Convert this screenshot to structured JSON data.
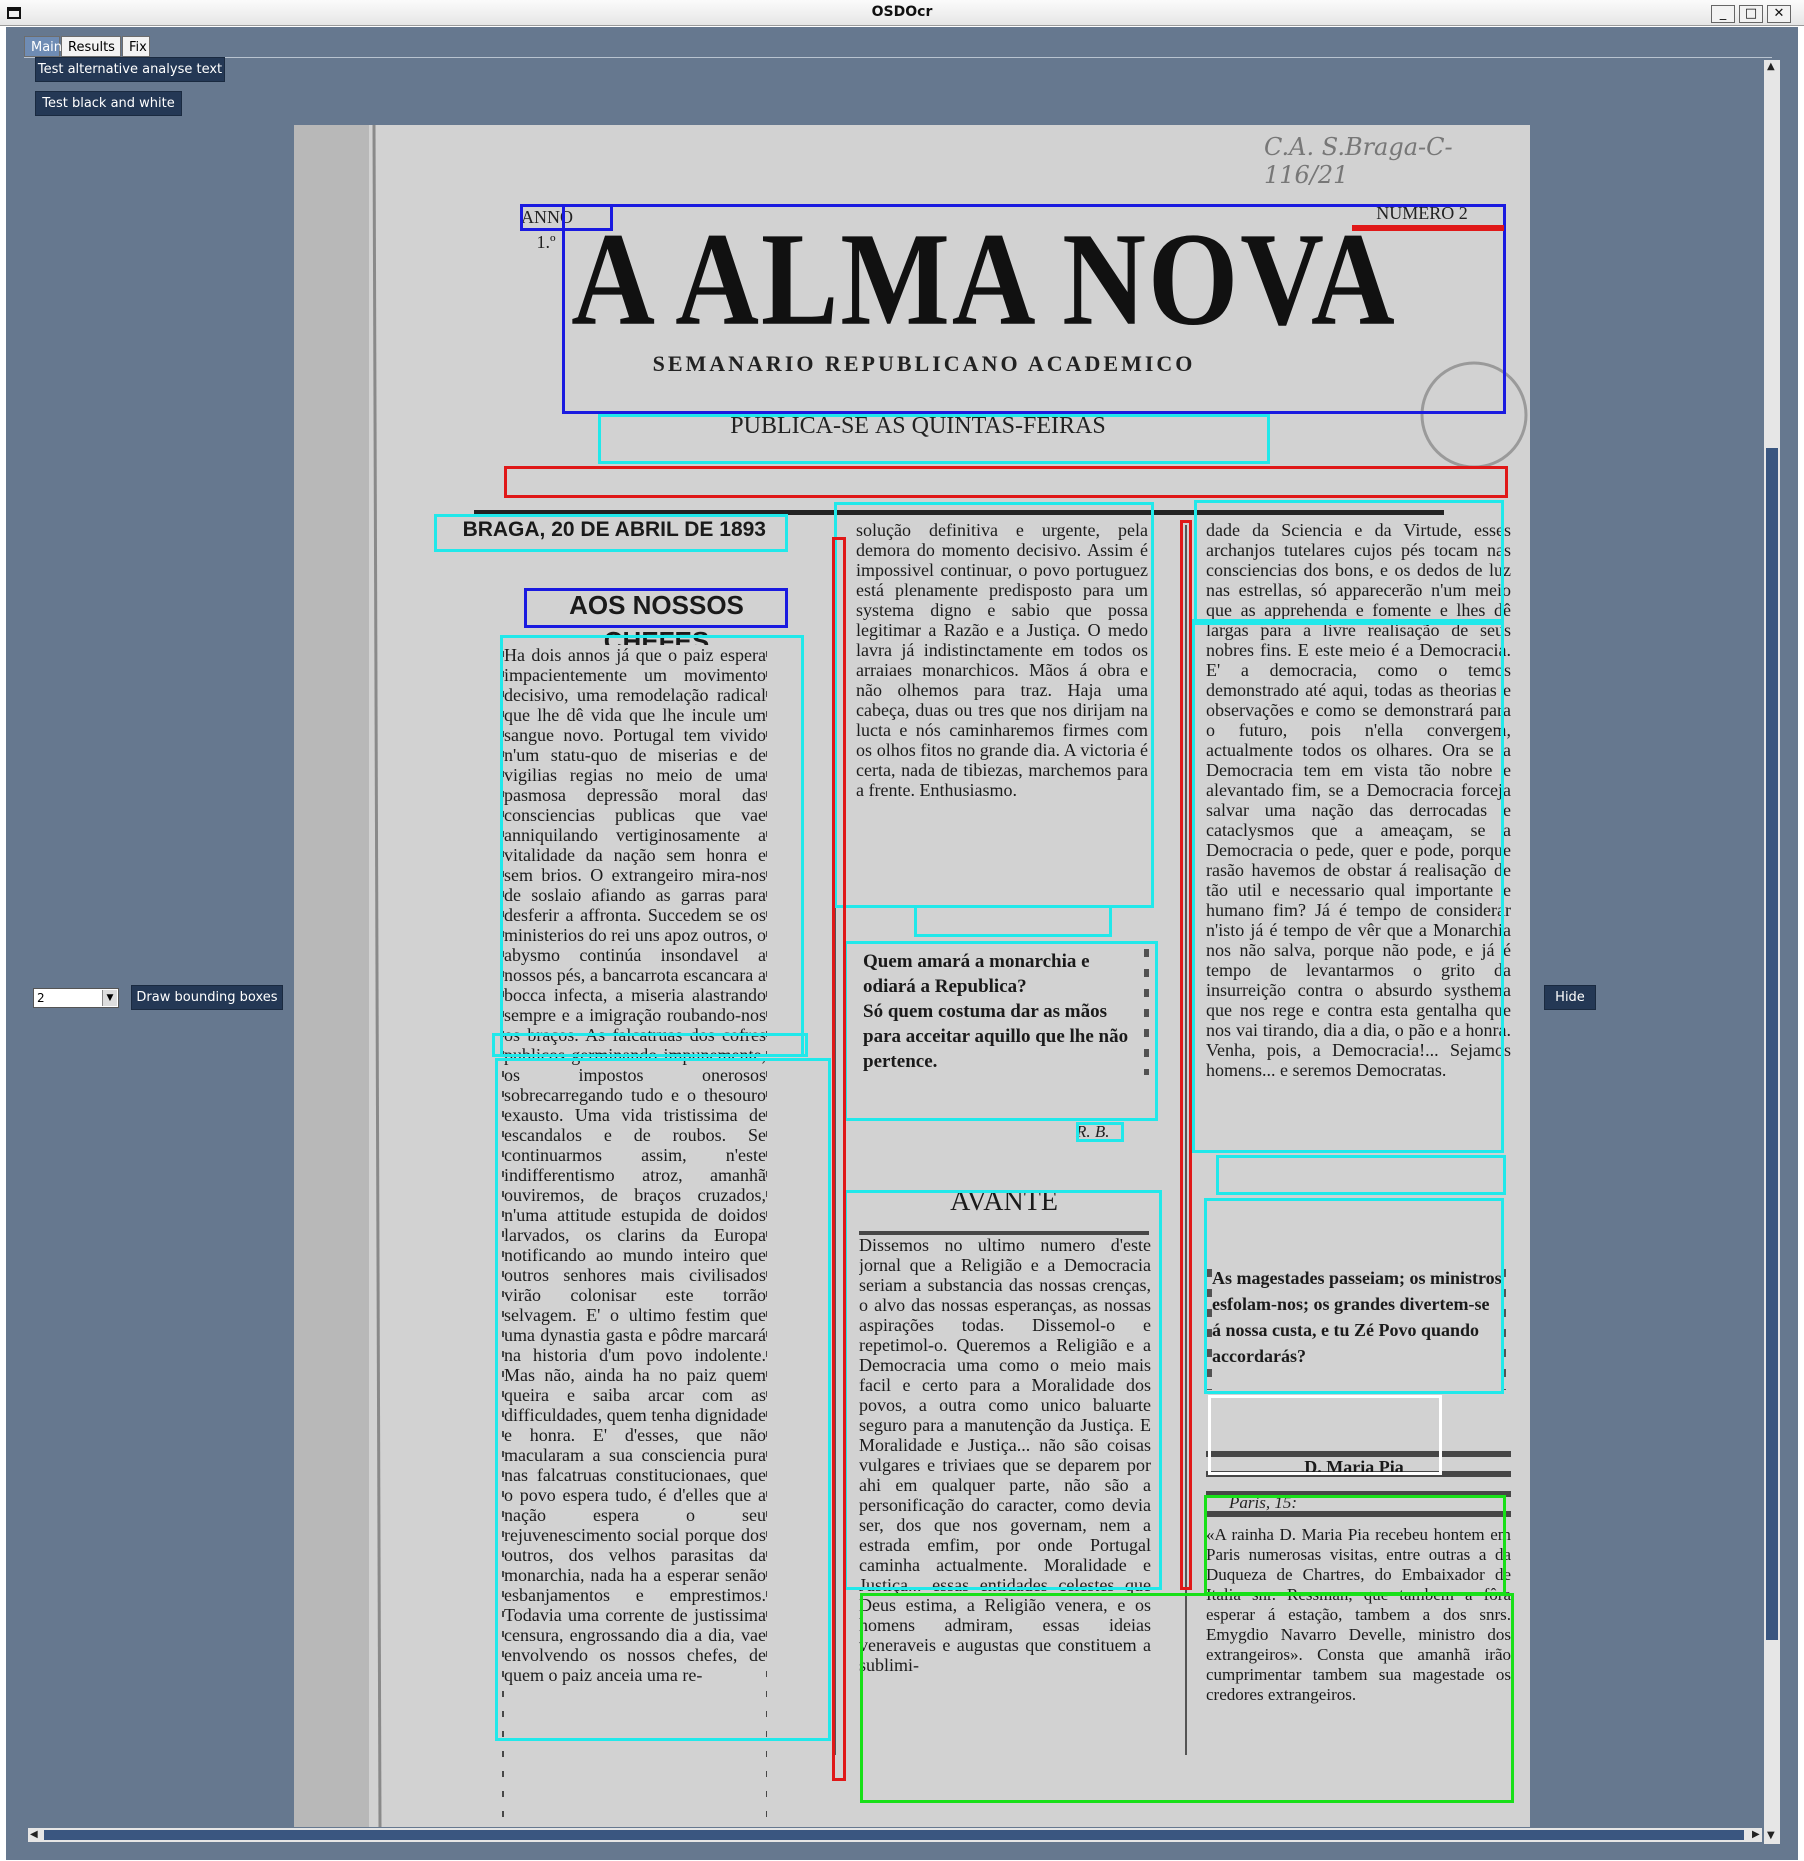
{
  "window": {
    "title": "OSDOcr",
    "minimize_label": "_",
    "maximize_label": "□",
    "close_label": "✕"
  },
  "tabs": [
    {
      "label": "Main",
      "active": true
    },
    {
      "label": "Results",
      "active": false
    },
    {
      "label": "Fix",
      "active": false
    }
  ],
  "buttons": {
    "test_alternative": "Test alternative analyse text",
    "test_black_white": "Test black and white",
    "draw_bounding_boxes": "Draw bounding boxes",
    "hide": "Hide"
  },
  "select": {
    "value": "2"
  },
  "newspaper": {
    "anno": "ANNO 1.º",
    "numero": "NUMERO 2",
    "handwritten": "C.A. S.Braga-C-116/21",
    "title": "A ALMA NOVA",
    "subtitle": "SEMANARIO REPUBLICANO ACADEMICO",
    "publication": "PUBLICA-SE ÁS QUINTAS-FEIRAS",
    "dateline": "BRAGA, 20 DE ABRIL DE 1893",
    "heading_left": "AOS NOSSOS CHEFES",
    "quote_bold": "Quem amará a monarchia e odiará a Republica?",
    "quote_bold2": "Só quem costuma dar as mãos para acceitar aquillo que lhe não pertence.",
    "signature_rb": "R. B.",
    "heading_avante": "AVANTE",
    "right_quote": "As magestades passeiam; os ministros esfolam-nos; os grandes divertem-se á nossa custa, e tu Zé Povo quando accordarás?",
    "signature_pia": "D. Maria Pia",
    "paris": "Paris, 15:",
    "col1": "Ha dois annos já que o paiz espera impacientemente um movimento decisivo, uma remodelação radical que lhe dê vida que lhe incule um sangue novo. Portugal tem vivido n'um statu-quo de miserias e de vigilias regias no meio de uma pasmosa depressão moral das consciencias publicas que vae anniquilando vertiginosamente a vitalidade da nação sem honra e sem brios. O extrangeiro mira-nos de soslaio afiando as garras para desferir a affronta. Succedem se os ministerios do rei uns apoz outros, o abysmo continúa insondavel a nossos pés, a bancarrota escancara a bocca infecta, a miseria alastrando sempre e a imigração roubando-nos os braços. As falcatruas dos cofres publicos germinando impunemente, os impostos onerosos sobrecarregando tudo e o thesouro exausto. Uma vida tristissima de escandalos e de roubos. Se continuarmos assim, n'este indifferentismo atroz, amanhã ouviremos, de braços cruzados, n'uma attitude estupida de doidos larvados, os clarins da Europa notificando ao mundo inteiro que outros senhores mais civilisados virão colonisar este torrão selvagem. E' o ultimo festim que uma dynastia gasta e pôdre marcará na historia d'um povo indolente. Mas não, ainda ha no paiz quem queira e saiba arcar com as difficuldades, quem tenha dignidade e honra. E' d'esses, que não macularam a sua consciencia pura nas falcatruas constitucionaes, que o povo espera tudo, é d'elles que a nação espera o seu rejuvenescimento social porque dos outros, dos velhos parasitas da monarchia, nada ha a esperar senão esbanjamentos e emprestimos. Todavia uma corrente de justissima censura, engrossando dia a dia, vae envolvendo os nossos chefes, de quem o paiz anceia uma re-",
    "col2": "solução definitiva e urgente, pela demora do momento decisivo. Assim é impossivel continuar, o povo portuguez está plenamente predisposto para um systema digno e sabio que possa legitimar a Razão e a Justiça. O medo lavra já indistinctamente em todos os arraiaes monarchicos. Mãos á obra e não olhemos para traz. Haja uma cabeça, duas ou tres que nos dirijam na lucta e nós caminharemos firmes com os olhos fitos no grande dia. A victoria é certa, nada de tibiezas, marchemos para a frente. Enthusiasmo.",
    "col2b": "Dissemos no ultimo numero d'este jornal que a Religião e a Democracia seriam a substancia das nossas crenças, o alvo das nossas esperanças, as nossas aspirações todas. Dissemol-o e repetimol-o. Queremos a Religião e a Democracia uma como o meio mais facil e certo para a Moralidade dos povos, a outra como unico baluarte seguro para a manutenção da Justiça. E Moralidade e Justiça... não são coisas vulgares e triviaes que se deparem por ahi em qualquer parte, não são a personificação do caracter, como devia ser, dos que nos governam, nem a estrada emfim, por onde Portugal caminha actualmente. Moralidade e Justiça... essas entidades celestes que Deus estima, a Religião venera, e os homens admiram, essas ideias veneraveis e augustas que constituem a sublimi-",
    "col3": "dade da Sciencia e da Virtude, esses archanjos tutelares cujos pés tocam nas consciencias dos bons, e os dedos de luz nas estrellas, só apparecerão n'um meio que as apprehenda e fomente e lhes dê largas para a livre realisação de seus nobres fins. E este meio é a Democracia. E' a democracia, como o temos demonstrado até aqui, todas as theorias e observações e como se demonstrará para o futuro, pois n'ella convergem, actualmente todos os olhares. Ora se a Democracia tem em vista tão nobre e alevantado fim, se a Democracia forceja salvar uma nação das derrocadas e cataclysmos que a ameaçam, se a Democracia o pede, quer e pode, porque rasão havemos de obstar á realisação de tão util e necessario qual importante e humano fim? Já é tempo de considerar n'isto já é tempo de vêr que a Monarchia nos não salva, porque não pode, e já é tempo de levantarmos o grito da insurreição contra o absurdo systhema que nos rege e contra esta gentalha que nos vai tirando, dia a dia, o pão e a honra. Venha, pois, a Democracia!... Sejamos homens... e seremos Democratas.",
    "col3b": "«A rainha D. Maria Pia recebeu hontem em Paris numerosas visitas, entre outras a da Duqueza de Chartres, do Embaixador de Italia snr. Ressman, que tambem a fôra esperar á estação, tambem a dos snrs. Emygdio Navarro Develle, ministro dos extrangeiros». Consta que amanhã irão cumprimentar tambem sua magestade os credores extrangeiros."
  }
}
